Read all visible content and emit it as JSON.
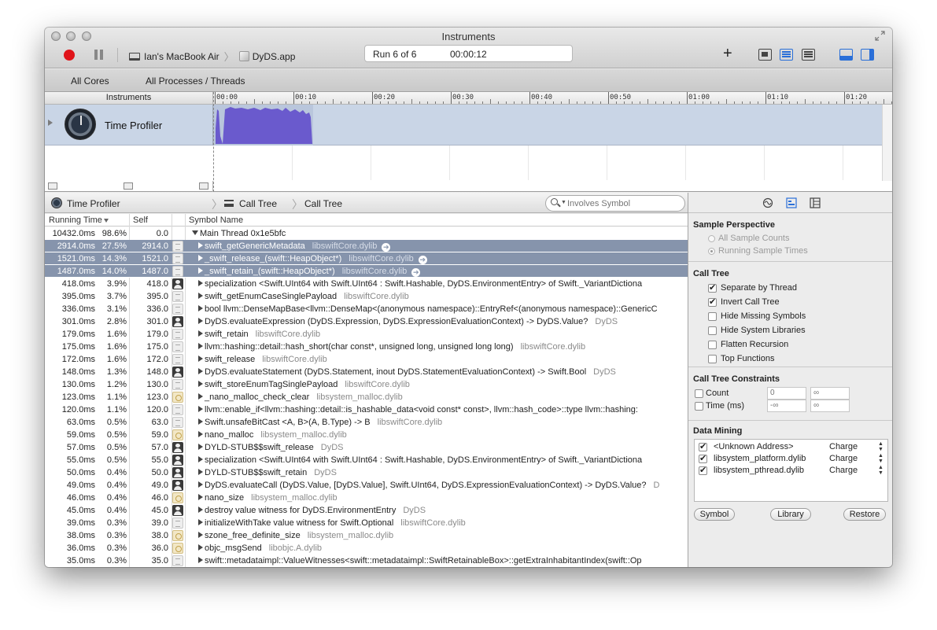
{
  "window": {
    "title": "Instruments"
  },
  "toolbar": {
    "device": "Ian's MacBook Air",
    "app": "DyDS.app",
    "run_label": "Run 6 of 6",
    "elapsed": "00:00:12",
    "plus_label": "+"
  },
  "scope": {
    "cores": "All Cores",
    "processes": "All Processes / Threads"
  },
  "track": {
    "header": "Instruments",
    "ruler_ticks": [
      "00:00",
      "00:10",
      "00:20",
      "00:30",
      "00:40",
      "00:50",
      "01:00",
      "01:10",
      "01:20"
    ],
    "instrument_name": "Time Profiler",
    "accent_color": "#6a5acd"
  },
  "detail": {
    "instrument": "Time Profiler",
    "crumb1": "Call Tree",
    "crumb2": "Call Tree",
    "search_placeholder": "Involves Symbol"
  },
  "table": {
    "headers": {
      "running_time": "Running Time",
      "self": "Self",
      "symbol": "Symbol Name"
    },
    "rows": [
      {
        "time": "10432.0ms",
        "pct": "98.6%",
        "self": "0.0",
        "icon": "none",
        "sym": "Main Thread  0x1e5bfc",
        "lib": "",
        "expanded": true,
        "indent": 0,
        "selected": false
      },
      {
        "time": "2914.0ms",
        "pct": "27.5%",
        "self": "2914.0",
        "icon": "lib",
        "sym": "swift_getGenericMetadata",
        "lib": "libswiftCore.dylib",
        "indent": 1,
        "selected": true
      },
      {
        "time": "1521.0ms",
        "pct": "14.3%",
        "self": "1521.0",
        "icon": "lib",
        "sym": "_swift_release_(swift::HeapObject*)",
        "lib": "libswiftCore.dylib",
        "indent": 1,
        "selected": true
      },
      {
        "time": "1487.0ms",
        "pct": "14.0%",
        "self": "1487.0",
        "icon": "lib",
        "sym": "_swift_retain_(swift::HeapObject*)",
        "lib": "libswiftCore.dylib",
        "indent": 1,
        "selected": true
      },
      {
        "time": "418.0ms",
        "pct": "3.9%",
        "self": "418.0",
        "icon": "user",
        "sym": "specialization <Swift.UInt64 with Swift.UInt64 : Swift.Hashable, DyDS.EnvironmentEntry> of Swift._VariantDictiona",
        "lib": "",
        "indent": 1,
        "selected": false
      },
      {
        "time": "395.0ms",
        "pct": "3.7%",
        "self": "395.0",
        "icon": "lib",
        "sym": "swift_getEnumCaseSinglePayload",
        "lib": "libswiftCore.dylib",
        "indent": 1,
        "selected": false
      },
      {
        "time": "336.0ms",
        "pct": "3.1%",
        "self": "336.0",
        "icon": "lib",
        "sym": "bool llvm::DenseMapBase<llvm::DenseMap<(anonymous namespace)::EntryRef<(anonymous namespace)::GenericC",
        "lib": "",
        "indent": 1,
        "selected": false
      },
      {
        "time": "301.0ms",
        "pct": "2.8%",
        "self": "301.0",
        "icon": "user",
        "sym": "DyDS.evaluateExpression (DyDS.Expression, DyDS.ExpressionEvaluationContext) -> DyDS.Value?",
        "lib": "DyDS",
        "indent": 1,
        "selected": false
      },
      {
        "time": "179.0ms",
        "pct": "1.6%",
        "self": "179.0",
        "icon": "lib",
        "sym": "swift_retain",
        "lib": "libswiftCore.dylib",
        "indent": 1,
        "selected": false
      },
      {
        "time": "175.0ms",
        "pct": "1.6%",
        "self": "175.0",
        "icon": "lib",
        "sym": "llvm::hashing::detail::hash_short(char const*, unsigned long, unsigned long long)",
        "lib": "libswiftCore.dylib",
        "indent": 1,
        "selected": false
      },
      {
        "time": "172.0ms",
        "pct": "1.6%",
        "self": "172.0",
        "icon": "lib",
        "sym": "swift_release",
        "lib": "libswiftCore.dylib",
        "indent": 1,
        "selected": false
      },
      {
        "time": "148.0ms",
        "pct": "1.3%",
        "self": "148.0",
        "icon": "user",
        "sym": "DyDS.evaluateStatement (DyDS.Statement, inout DyDS.StatementEvaluationContext) -> Swift.Bool",
        "lib": "DyDS",
        "indent": 1,
        "selected": false
      },
      {
        "time": "130.0ms",
        "pct": "1.2%",
        "self": "130.0",
        "icon": "lib",
        "sym": "swift_storeEnumTagSinglePayload",
        "lib": "libswiftCore.dylib",
        "indent": 1,
        "selected": false
      },
      {
        "time": "123.0ms",
        "pct": "1.1%",
        "self": "123.0",
        "icon": "gear",
        "sym": "_nano_malloc_check_clear",
        "lib": "libsystem_malloc.dylib",
        "indent": 1,
        "selected": false
      },
      {
        "time": "120.0ms",
        "pct": "1.1%",
        "self": "120.0",
        "icon": "lib",
        "sym": "llvm::enable_if<llvm::hashing::detail::is_hashable_data<void const* const>, llvm::hash_code>::type llvm::hashing:",
        "lib": "",
        "indent": 1,
        "selected": false
      },
      {
        "time": "63.0ms",
        "pct": "0.5%",
        "self": "63.0",
        "icon": "lib",
        "sym": "Swift.unsafeBitCast <A, B>(A, B.Type) -> B",
        "lib": "libswiftCore.dylib",
        "indent": 1,
        "selected": false
      },
      {
        "time": "59.0ms",
        "pct": "0.5%",
        "self": "59.0",
        "icon": "gear",
        "sym": "nano_malloc",
        "lib": "libsystem_malloc.dylib",
        "indent": 1,
        "selected": false
      },
      {
        "time": "57.0ms",
        "pct": "0.5%",
        "self": "57.0",
        "icon": "user",
        "sym": "DYLD-STUB$$swift_release",
        "lib": "DyDS",
        "indent": 1,
        "selected": false
      },
      {
        "time": "55.0ms",
        "pct": "0.5%",
        "self": "55.0",
        "icon": "user",
        "sym": "specialization <Swift.UInt64 with Swift.UInt64 : Swift.Hashable, DyDS.EnvironmentEntry> of Swift._VariantDictiona",
        "lib": "",
        "indent": 1,
        "selected": false
      },
      {
        "time": "50.0ms",
        "pct": "0.4%",
        "self": "50.0",
        "icon": "user",
        "sym": "DYLD-STUB$$swift_retain",
        "lib": "DyDS",
        "indent": 1,
        "selected": false
      },
      {
        "time": "49.0ms",
        "pct": "0.4%",
        "self": "49.0",
        "icon": "user",
        "sym": "DyDS.evaluateCall (DyDS.Value, [DyDS.Value], Swift.UInt64, DyDS.ExpressionEvaluationContext) -> DyDS.Value?",
        "lib": "D",
        "indent": 1,
        "selected": false
      },
      {
        "time": "46.0ms",
        "pct": "0.4%",
        "self": "46.0",
        "icon": "gear",
        "sym": "nano_size",
        "lib": "libsystem_malloc.dylib",
        "indent": 1,
        "selected": false
      },
      {
        "time": "45.0ms",
        "pct": "0.4%",
        "self": "45.0",
        "icon": "user",
        "sym": "destroy value witness for DyDS.EnvironmentEntry",
        "lib": "DyDS",
        "indent": 1,
        "selected": false
      },
      {
        "time": "39.0ms",
        "pct": "0.3%",
        "self": "39.0",
        "icon": "lib",
        "sym": "initializeWithTake value witness for Swift.Optional",
        "lib": "libswiftCore.dylib",
        "indent": 1,
        "selected": false
      },
      {
        "time": "38.0ms",
        "pct": "0.3%",
        "self": "38.0",
        "icon": "gear",
        "sym": "szone_free_definite_size",
        "lib": "libsystem_malloc.dylib",
        "indent": 1,
        "selected": false
      },
      {
        "time": "36.0ms",
        "pct": "0.3%",
        "self": "36.0",
        "icon": "gear",
        "sym": "objc_msgSend",
        "lib": "libobjc.A.dylib",
        "indent": 1,
        "selected": false
      },
      {
        "time": "35.0ms",
        "pct": "0.3%",
        "self": "35.0",
        "icon": "lib",
        "sym": "swift::metadataimpl::ValueWitnesses<swift::metadataimpl::SwiftRetainableBox>::getExtraInhabitantIndex(swift::Op",
        "lib": "",
        "indent": 1,
        "selected": false
      }
    ]
  },
  "inspector": {
    "sample_perspective": {
      "title": "Sample Perspective",
      "options": [
        {
          "label": "All Sample Counts",
          "selected": false
        },
        {
          "label": "Running Sample Times",
          "selected": true
        }
      ]
    },
    "call_tree": {
      "title": "Call Tree",
      "options": [
        {
          "label": "Separate by Thread",
          "checked": true
        },
        {
          "label": "Invert Call Tree",
          "checked": true
        },
        {
          "label": "Hide Missing Symbols",
          "checked": false
        },
        {
          "label": "Hide System Libraries",
          "checked": false
        },
        {
          "label": "Flatten Recursion",
          "checked": false
        },
        {
          "label": "Top Functions",
          "checked": false
        }
      ]
    },
    "constraints": {
      "title": "Call Tree Constraints",
      "count": {
        "label": "Count",
        "min": "0",
        "max": "∞"
      },
      "time": {
        "label": "Time (ms)",
        "min": "-∞",
        "max": "∞"
      }
    },
    "data_mining": {
      "title": "Data Mining",
      "rows": [
        {
          "name": "<Unknown Address>",
          "action": "Charge",
          "checked": true
        },
        {
          "name": "libsystem_platform.dylib",
          "action": "Charge",
          "checked": true
        },
        {
          "name": "libsystem_pthread.dylib",
          "action": "Charge",
          "checked": true
        }
      ],
      "buttons": {
        "symbol": "Symbol",
        "library": "Library",
        "restore": "Restore"
      }
    }
  }
}
